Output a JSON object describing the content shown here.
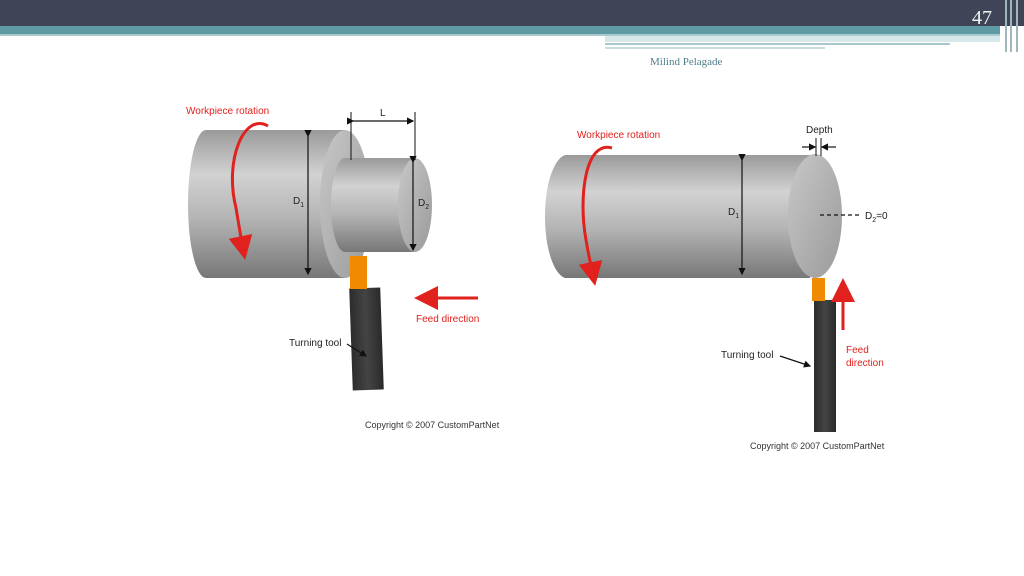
{
  "slide": {
    "number": "47",
    "author": "Milind Pelagade"
  },
  "left_figure": {
    "rotation_label": "Workpiece rotation",
    "length_label": "L",
    "d1_label": "D",
    "d1_sub": "1",
    "d2_label": "D",
    "d2_sub": "2",
    "feed_label": "Feed direction",
    "tool_label": "Turning tool",
    "copyright": "Copyright © 2007 CustomPartNet"
  },
  "right_figure": {
    "rotation_label": "Workpiece rotation",
    "depth_label": "Depth",
    "d1_label": "D",
    "d1_sub": "1",
    "d2_label": "D",
    "d2_sub": "2",
    "d2_value": "=0",
    "feed_label_line1": "Feed",
    "feed_label_line2": "direction",
    "tool_label": "Turning tool",
    "copyright": "Copyright © 2007 CustomPartNet"
  },
  "colors": {
    "header_dark": "#3f4457",
    "header_teal": "#5e9aa3",
    "arrow_red": "#e0211d",
    "tool_orange": "#f08a00",
    "tool_dark": "#333333"
  }
}
